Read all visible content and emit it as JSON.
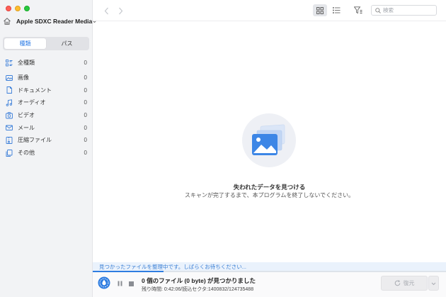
{
  "sidebar": {
    "device_name": "Apple SDXC Reader Media",
    "tabs": [
      {
        "label": "種類",
        "active": true
      },
      {
        "label": "パス",
        "active": false
      }
    ],
    "categories": [
      {
        "label": "全種類",
        "count": "0",
        "icon": "all-types-icon"
      },
      {
        "label": "画像",
        "count": "0",
        "icon": "image-icon"
      },
      {
        "label": "ドキュメント",
        "count": "0",
        "icon": "document-icon"
      },
      {
        "label": "オーディオ",
        "count": "0",
        "icon": "audio-icon"
      },
      {
        "label": "ビデオ",
        "count": "0",
        "icon": "video-icon"
      },
      {
        "label": "メール",
        "count": "0",
        "icon": "mail-icon"
      },
      {
        "label": "圧縮ファイル",
        "count": "0",
        "icon": "archive-icon"
      },
      {
        "label": "その他",
        "count": "0",
        "icon": "other-icon"
      }
    ]
  },
  "toolbar": {
    "search_placeholder": "検索"
  },
  "empty_state": {
    "title": "失われたデータを見つける",
    "subtitle": "スキャンが完了するまで、本プログラムを終了しないでください。"
  },
  "status": {
    "scanning_message": "見つかったファイルを整理中です。しばらくお待ちください...",
    "progress": 0.2,
    "found_text": "0 個のファイル (0 byte) が見つかりました",
    "detail_text": "残り時間: 0:42:06/読込セクタ:1400832/124735488",
    "recover_label": "復元"
  },
  "colors": {
    "accent": "#2f7de1",
    "sidebar_bg": "#f2f3f5",
    "icon_blue": "#3c7fd9"
  }
}
